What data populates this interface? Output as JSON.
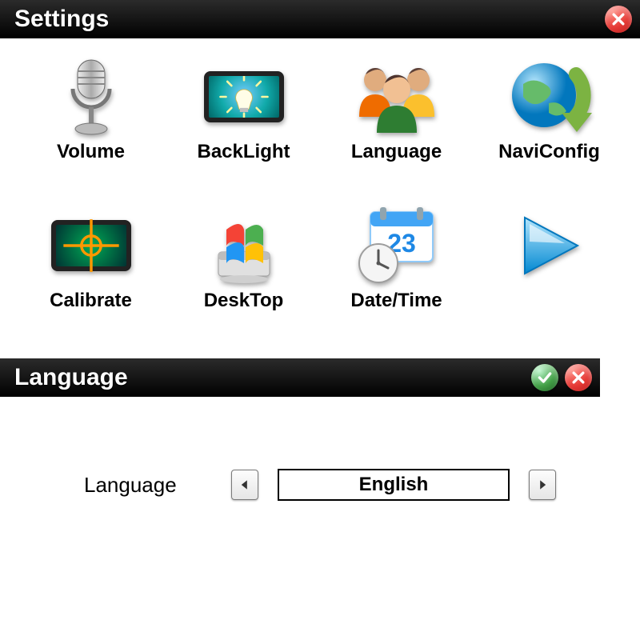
{
  "settings": {
    "title": "Settings",
    "tiles": [
      {
        "label": "Volume",
        "icon": "microphone-icon"
      },
      {
        "label": "BackLight",
        "icon": "backlight-icon"
      },
      {
        "label": "Language",
        "icon": "people-icon"
      },
      {
        "label": "NaviConfig",
        "icon": "globe-arrow-icon"
      },
      {
        "label": "Calibrate",
        "icon": "calibrate-icon"
      },
      {
        "label": "DeskTop",
        "icon": "desktop-icon"
      },
      {
        "label": "Date/Time",
        "icon": "datetime-icon",
        "day": "23"
      }
    ]
  },
  "language": {
    "title": "Language",
    "field_label": "Language",
    "value": "English"
  }
}
